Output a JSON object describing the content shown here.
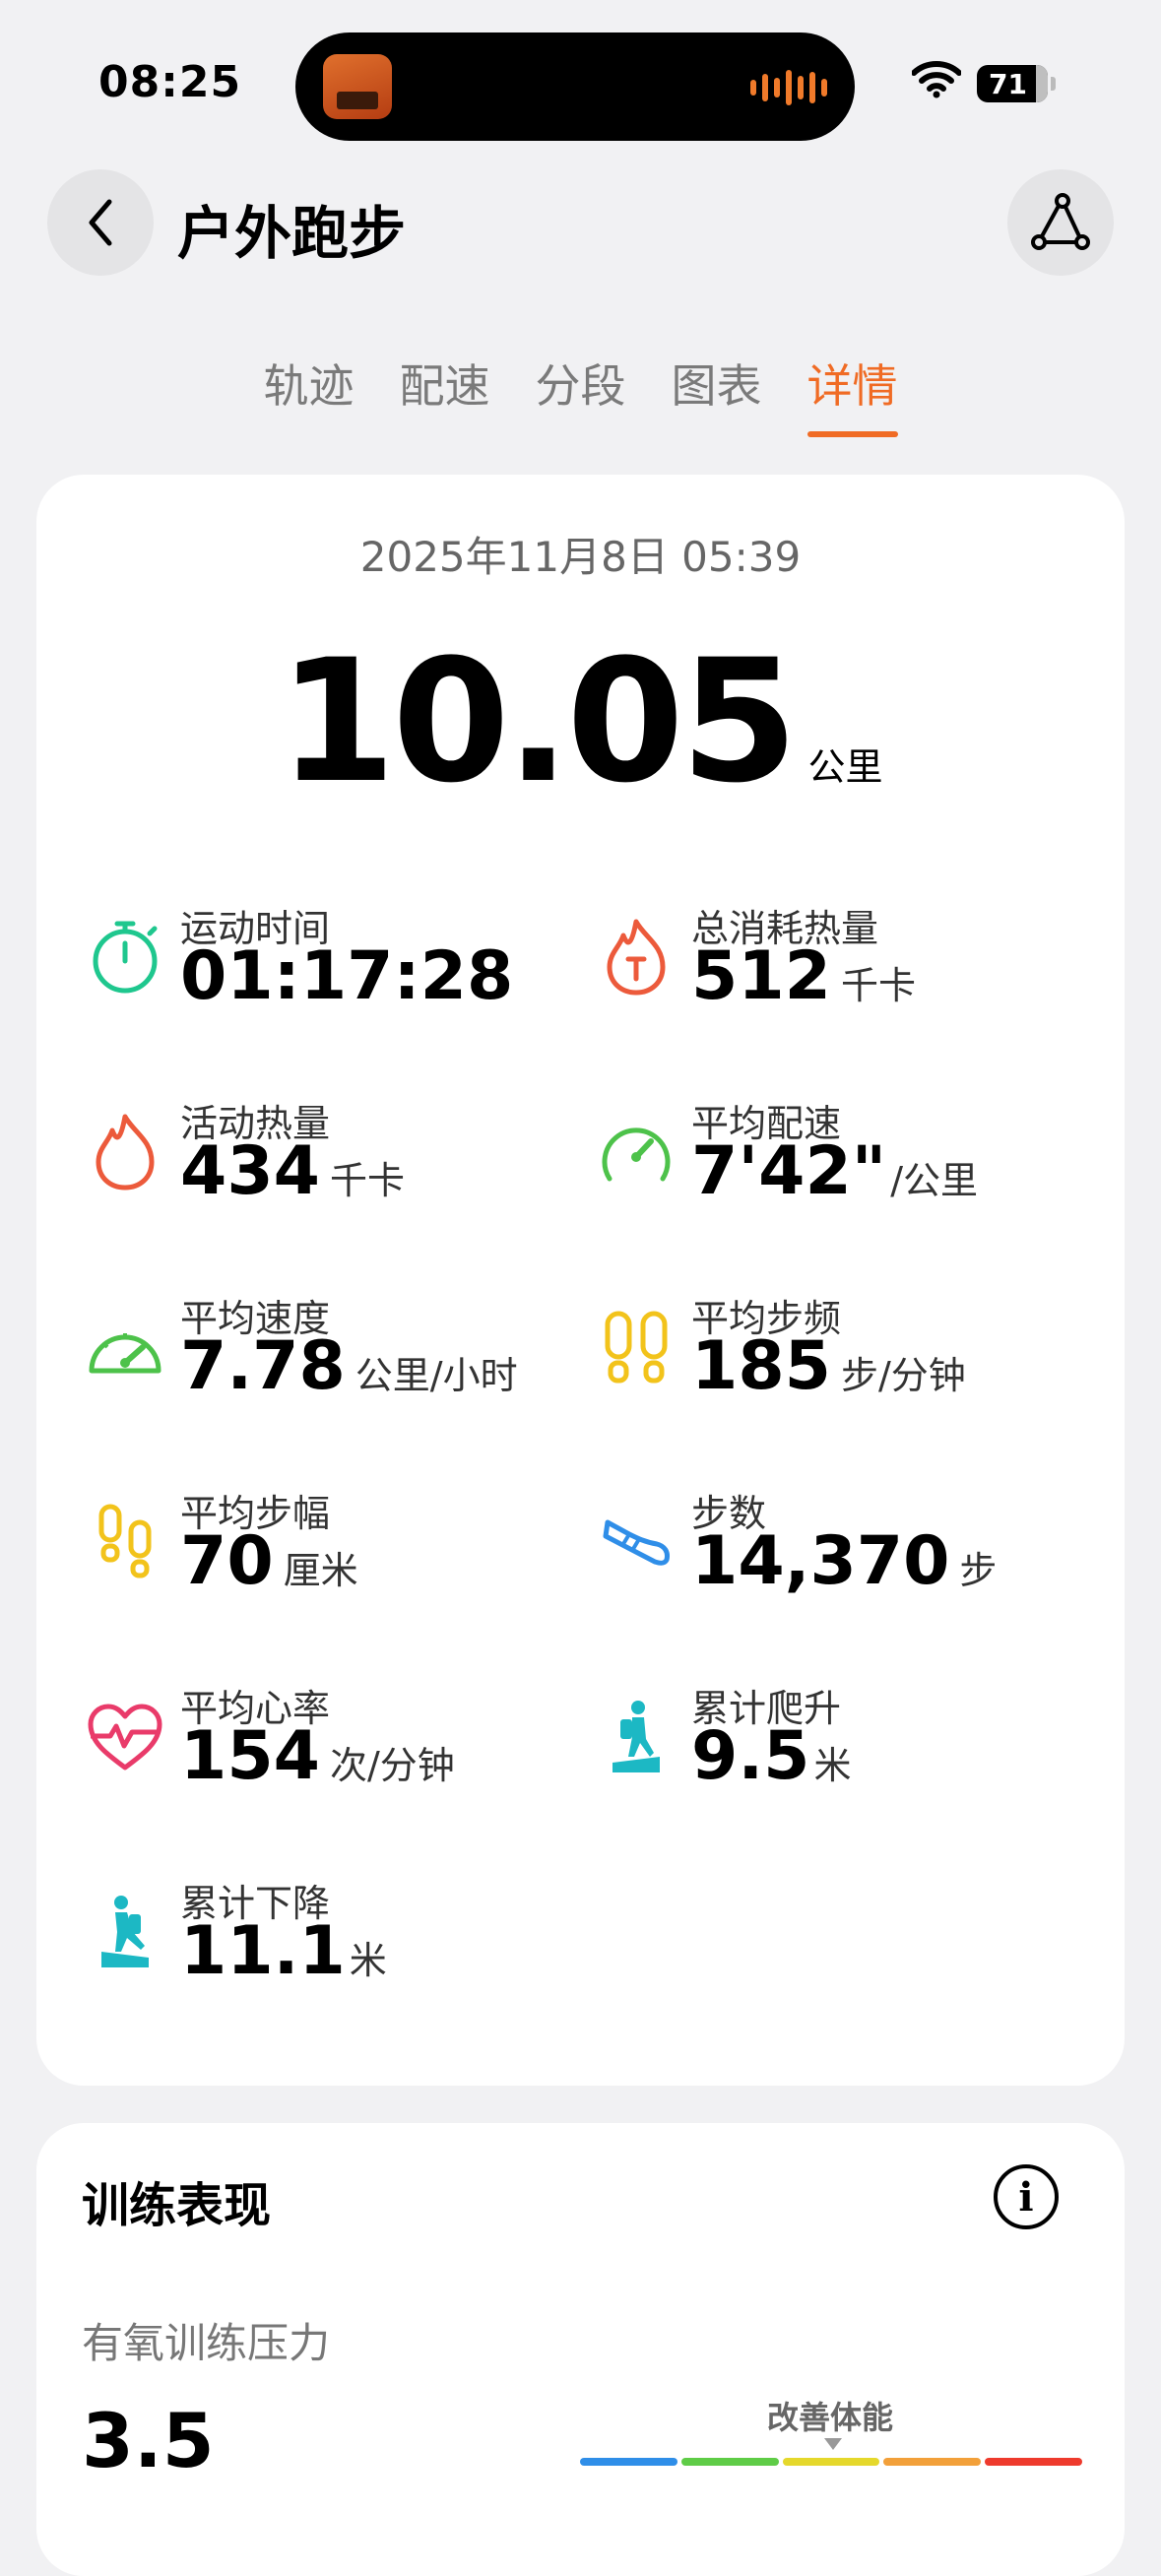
{
  "status_bar": {
    "time": "08:25",
    "battery": "71"
  },
  "header": {
    "title": "户外跑步"
  },
  "tabs": [
    {
      "label": "轨迹",
      "active": false
    },
    {
      "label": "配速",
      "active": false
    },
    {
      "label": "分段",
      "active": false
    },
    {
      "label": "图表",
      "active": false
    },
    {
      "label": "详情",
      "active": true
    }
  ],
  "summary": {
    "date": "2025年11月8日 05:39",
    "distance": "10.05",
    "distance_unit": "公里"
  },
  "metrics": [
    {
      "label": "运动时间",
      "value": "01:17:28",
      "unit": "",
      "icon": "stopwatch-icon"
    },
    {
      "label": "总消耗热量",
      "value": "512",
      "unit": "千卡",
      "icon": "total-calories-icon"
    },
    {
      "label": "活动热量",
      "value": "434",
      "unit": "千卡",
      "icon": "flame-icon"
    },
    {
      "label": "平均配速",
      "value": "7'42\"",
      "unit": "/公里",
      "icon": "pace-gauge-icon"
    },
    {
      "label": "平均速度",
      "value": "7.78",
      "unit": "公里/小时",
      "icon": "speedometer-icon"
    },
    {
      "label": "平均步频",
      "value": "185",
      "unit": "步/分钟",
      "icon": "footprints-icon"
    },
    {
      "label": "平均步幅",
      "value": "70",
      "unit": "厘米",
      "icon": "stride-footprints-icon"
    },
    {
      "label": "步数",
      "value": "14,370",
      "unit": "步",
      "icon": "shoe-icon"
    },
    {
      "label": "平均心率",
      "value": "154",
      "unit": "次/分钟",
      "icon": "heart-rate-icon"
    },
    {
      "label": "累计爬升",
      "value": "9.5",
      "unit": "米",
      "icon": "hiker-ascent-icon"
    },
    {
      "label": "累计下降",
      "value": "11.1",
      "unit": "米",
      "icon": "hiker-descent-icon"
    }
  ],
  "training": {
    "title": "训练表现",
    "aerobic_label": "有氧训练压力",
    "aerobic_value": "3.5",
    "scale_label": "改善体能",
    "scale_colors": [
      "#2f8ee8",
      "#5fcc47",
      "#e5d82c",
      "#f2a03a",
      "#ee3a2d"
    ]
  },
  "colors": {
    "accent": "#f06b24"
  }
}
